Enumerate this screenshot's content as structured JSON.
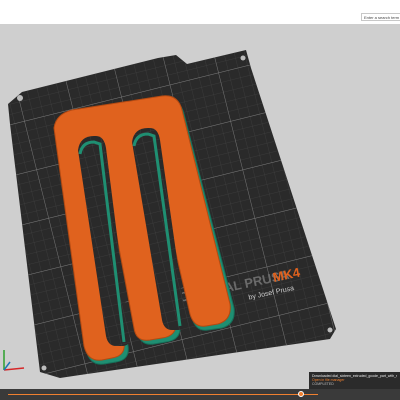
{
  "search": {
    "placeholder": "Enter a search term"
  },
  "bed": {
    "brand_text": "ORIGINAL PRUSA",
    "model_text": "MK4",
    "byline": "by Josef Prusa"
  },
  "notification": {
    "line1": "Downloaded dial_sixteen_extruded_gcode_part_with_reliefs",
    "link_text": "Open in file manager",
    "status": "COMPLETED"
  },
  "colors": {
    "part_orange": "#e0621e",
    "part_teal": "#1f8f72",
    "bed_black": "#2a2a2a",
    "accent": "#f08030"
  }
}
